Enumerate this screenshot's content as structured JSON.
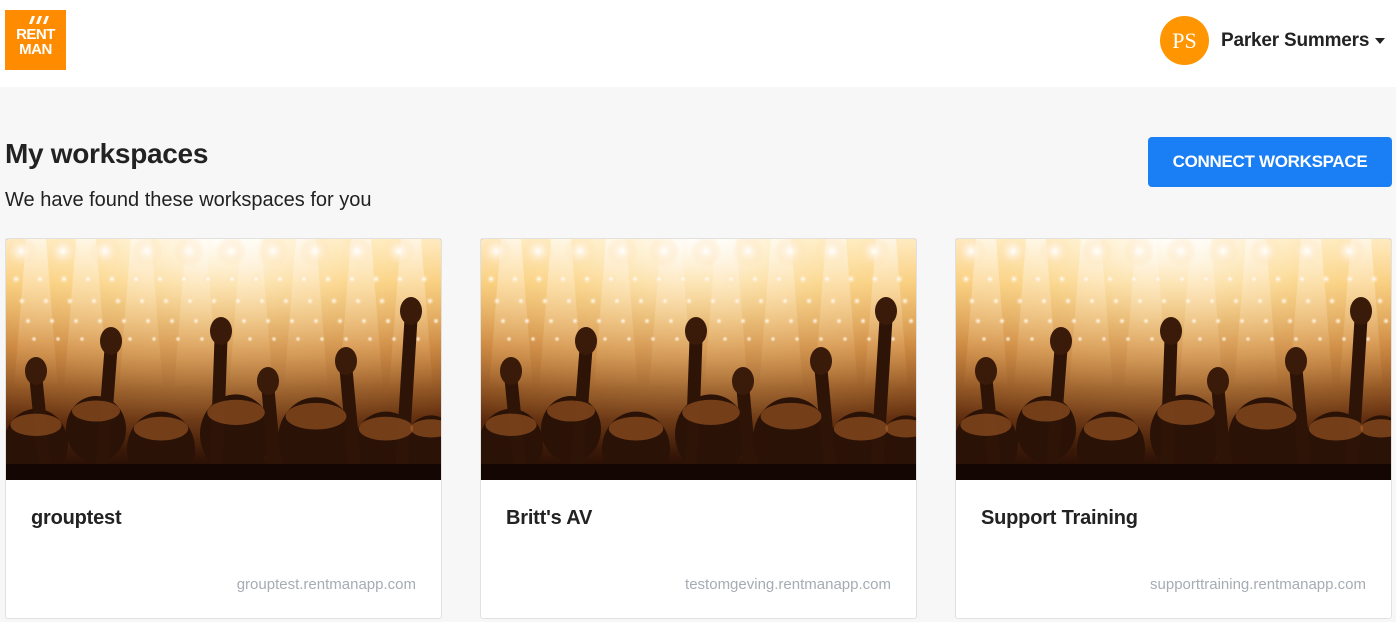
{
  "brand": {
    "logo_line1": "RENT",
    "logo_line2": "MAN",
    "color": "#ff8c00"
  },
  "user": {
    "initials": "PS",
    "name": "Parker Summers",
    "avatar_color": "#ff9500",
    "menu_icon": "caret-down-icon"
  },
  "page": {
    "title": "My workspaces",
    "subtitle": "We have found these workspaces for you",
    "connect_label": "CONNECT WORKSPACE",
    "accent": "#1a7ef5"
  },
  "workspaces": [
    {
      "name": "grouptest",
      "url": "grouptest.rentmanapp.com",
      "image": "concert-crowd-photo"
    },
    {
      "name": "Britt's AV",
      "url": "testomgeving.rentmanapp.com",
      "image": "concert-crowd-photo"
    },
    {
      "name": "Support Training",
      "url": "supporttraining.rentmanapp.com",
      "image": "concert-crowd-photo"
    }
  ]
}
